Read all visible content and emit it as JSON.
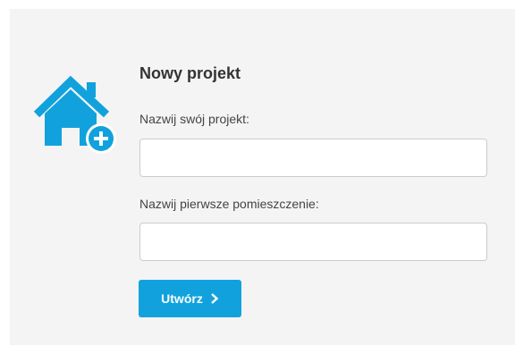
{
  "form": {
    "title": "Nowy projekt",
    "project_name_label": "Nazwij swój projekt:",
    "project_name_value": "",
    "room_name_label": "Nazwij pierwsze pomieszczenie:",
    "room_name_value": "",
    "create_label": "Utwórz"
  },
  "icons": {
    "house": "house-add-icon",
    "create_chevron": "chevron-right-icon"
  },
  "colors": {
    "accent": "#11a2dd",
    "panel_background": "#f4f4f4",
    "input_border": "#cccccc",
    "title_text": "#333333"
  }
}
